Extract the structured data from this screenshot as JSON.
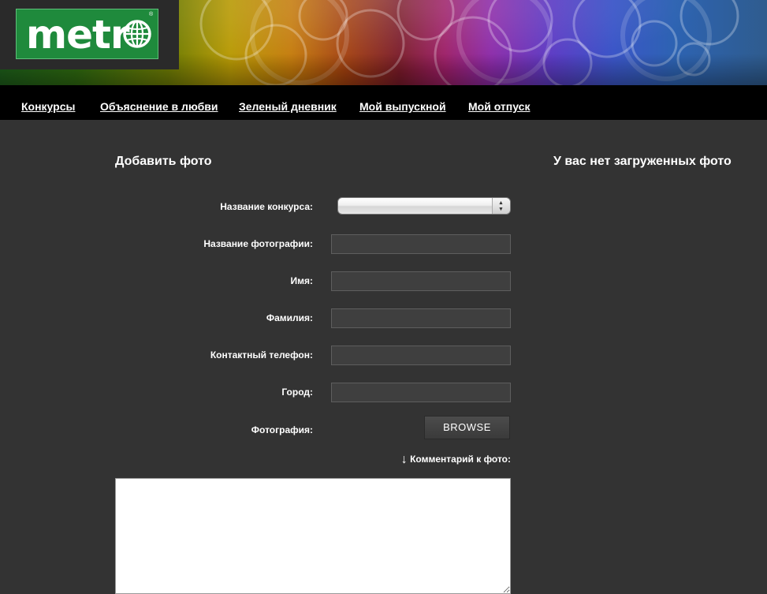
{
  "header": {
    "logo_text": "metr",
    "logo_registered": "®"
  },
  "nav": {
    "items": [
      {
        "label": "Конкурсы"
      },
      {
        "label": "Объяснение в любви"
      },
      {
        "label": "Зеленый дневник"
      },
      {
        "label": "Мой выпускной"
      },
      {
        "label": "Мой отпуск"
      }
    ]
  },
  "form": {
    "title": "Добавить фото",
    "contest_label": "Название конкурса:",
    "contest_selected": "",
    "photo_title_label": "Название фотографии:",
    "first_name_label": "Имя:",
    "last_name_label": "Фамилия:",
    "phone_label": "Контактный телефон:",
    "city_label": "Город:",
    "photo_label": "Фотография:",
    "browse_label": "BROWSE",
    "comment_arrow": "↓",
    "comment_label": "Комментарий к фото:"
  },
  "sidebar": {
    "empty_message": "У вас нет загруженных фото"
  },
  "colors": {
    "background": "#333333",
    "nav_background": "#000000",
    "logo_green": "#1f8a3c"
  },
  "icons": {
    "logo_o": "globe-icon",
    "select_arrows": "up-down-arrows-icon"
  }
}
